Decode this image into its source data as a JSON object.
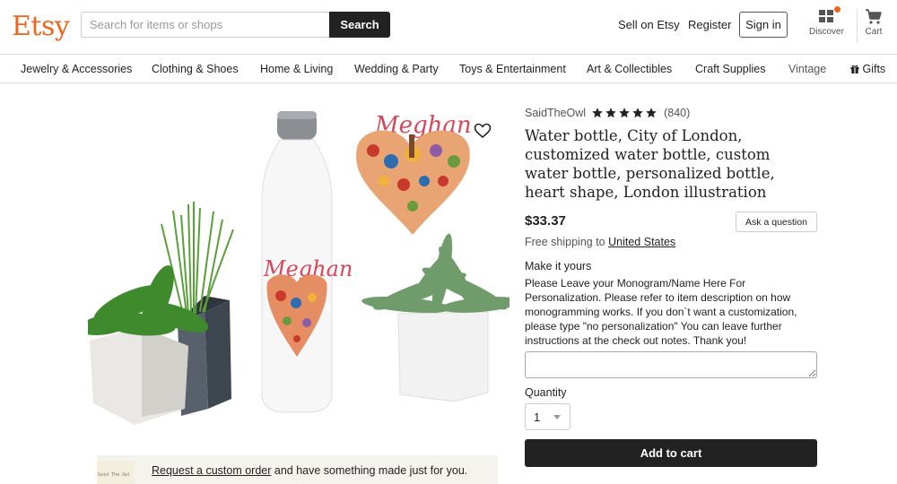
{
  "header": {
    "logo": "Etsy",
    "search_placeholder": "Search for items or shops",
    "search_button": "Search",
    "sell_on_etsy": "Sell on Etsy",
    "register": "Register",
    "sign_in": "Sign in",
    "discover": "Discover",
    "cart": "Cart",
    "icons": [
      "discover-icon",
      "cart-icon"
    ]
  },
  "nav": {
    "items": [
      "Jewelry & Accessories",
      "Clothing & Shoes",
      "Home & Living",
      "Wedding & Party",
      "Toys & Entertainment",
      "Art & Collectibles",
      "Craft Supplies",
      "Vintage",
      "Gifts"
    ]
  },
  "product": {
    "shop_name": "SaidTheOwl",
    "rating": 5,
    "review_count": "(840)",
    "title": "Water bottle, City of London, customized water bottle, custom water bottle, personalized bottle, heart shape, London illustration",
    "price": "$33.37",
    "ask_question": "Ask a question",
    "shipping_prefix": "Free shipping to",
    "shipping_country": "United States",
    "image_name_text": "Meghan",
    "make_it_yours": "Make it yours",
    "instructions": "Please Leave your Monogram/Name Here For Personalization. Please refer to item description on how monogramming works. If you don`t want a customization, please type \"no personalization\" You can leave further instructions at the check out notes. Thank you!",
    "quantity_label": "Quantity",
    "quantity_value": "1",
    "add_to_cart": "Add to cart"
  },
  "custom_order": {
    "shop_thumb_text": "Said The Owl",
    "link_text": "Request a custom order",
    "rest_text": " and have something made just for you."
  },
  "colors": {
    "brand_orange": "#F1641E",
    "button_dark": "#222222",
    "banner_bg": "#F5F3EE"
  }
}
